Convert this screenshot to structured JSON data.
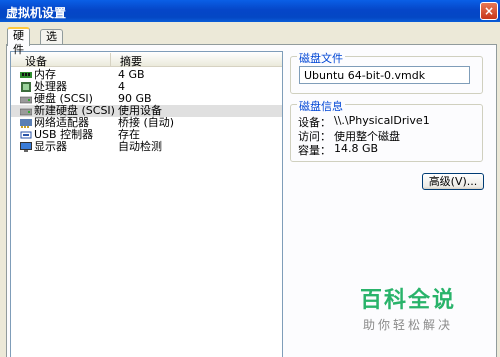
{
  "window": {
    "title": "虚拟机设置",
    "close_glyph": "×"
  },
  "tabs": [
    {
      "label": "硬件"
    },
    {
      "label": "选项"
    }
  ],
  "device_list": {
    "columns": [
      "设备",
      "摘要"
    ],
    "rows": [
      {
        "name": "内存",
        "summary": "4 GB",
        "icon": "memory-icon"
      },
      {
        "name": "处理器",
        "summary": "4",
        "icon": "cpu-icon"
      },
      {
        "name": "硬盘 (SCSI)",
        "summary": "90 GB",
        "icon": "harddisk-icon"
      },
      {
        "name": "新建硬盘 (SCSI)",
        "summary": "使用设备",
        "icon": "harddisk-icon",
        "selected": true
      },
      {
        "name": "网络适配器",
        "summary": "桥接 (自动)",
        "icon": "network-adapter-icon"
      },
      {
        "name": "USB 控制器",
        "summary": "存在",
        "icon": "usb-icon"
      },
      {
        "name": "显示器",
        "summary": "自动检测",
        "icon": "monitor-icon"
      }
    ]
  },
  "disk_file": {
    "title": "磁盘文件",
    "value": "Ubuntu 64-bit-0.vmdk"
  },
  "disk_info": {
    "title": "磁盘信息",
    "device_label": "设备：",
    "device_value": "\\\\.\\PhysicalDrive1",
    "access_label": "访问：",
    "access_value": "使用整个磁盘",
    "capacity_label": "容量：",
    "capacity_value": "14.8 GB"
  },
  "advanced_button": {
    "label": "高级(V)..."
  },
  "watermark": {
    "title": "百科全说",
    "subtitle": "助你轻松解决"
  },
  "colors": {
    "title_bar": "#0A5FE6",
    "group_title": "#0046D5",
    "watermark": "#29B36A"
  }
}
